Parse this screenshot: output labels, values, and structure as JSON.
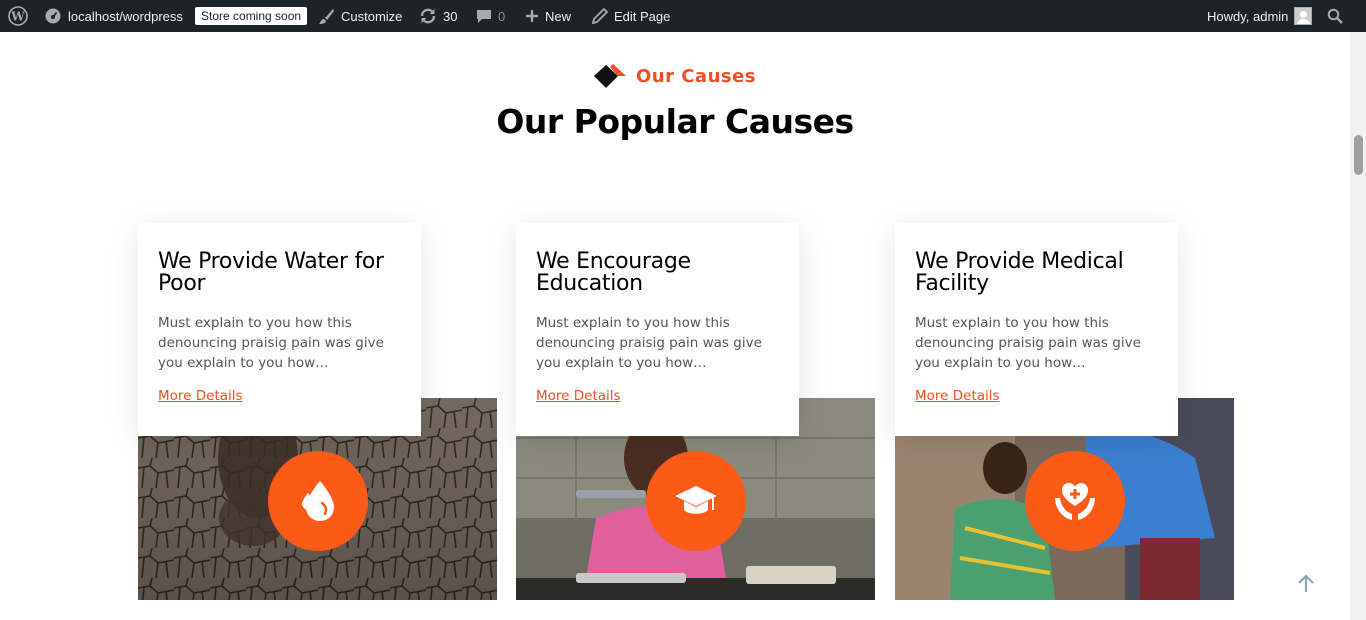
{
  "adminbar": {
    "site": "localhost/wordpress",
    "store_badge": "Store coming soon",
    "customize": "Customize",
    "updates_count": "30",
    "comments_count": "0",
    "new_label": "New",
    "edit_label": "Edit Page",
    "howdy": "Howdy, admin"
  },
  "section": {
    "label": "Our Causes",
    "title": "Our Popular Causes"
  },
  "causes": [
    {
      "title": "We Provide Water for Poor",
      "text": "Must explain to you how this denouncing praisig pain was give you explain to you how…",
      "link": "More Details",
      "icon": "water-drop-icon"
    },
    {
      "title": "We Encourage Education",
      "text": "Must explain to you how this denouncing praisig pain was give you explain to you how…",
      "link": "More Details",
      "icon": "graduation-cap-icon"
    },
    {
      "title": "We Provide Medical Facility",
      "text": "Must explain to you how this denouncing praisig pain was give you explain to you how…",
      "link": "More Details",
      "icon": "hands-heart-icon"
    }
  ],
  "colors": {
    "accent": "#f04e23",
    "badge": "#fb5a17",
    "adminbar": "#1d2327"
  }
}
